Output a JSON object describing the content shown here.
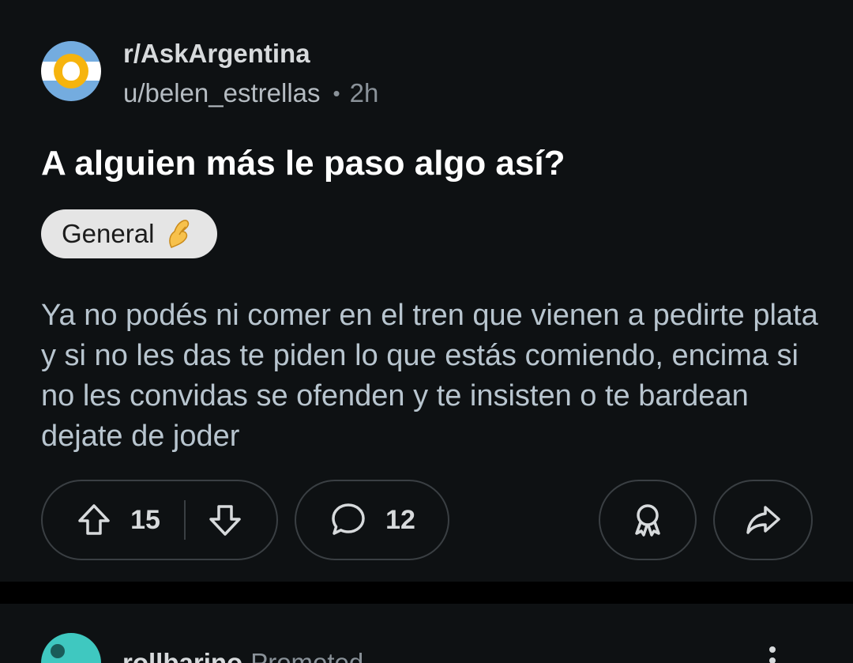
{
  "post": {
    "subreddit": "r/AskArgentina",
    "author": "u/belen_estrellas",
    "separator": "•",
    "time": "2h",
    "title": "A alguien más le paso algo así?",
    "flair": {
      "label": "General",
      "emoji": "pinched-fingers-emoji"
    },
    "body": "Ya no podés ni comer en el tren que vienen a pedirte plata y si no les das te piden lo que estás comiendo, encima si no les convidas se ofenden y te insisten o te bardean dejate de joder",
    "actions": {
      "upvotes": "15",
      "comments": "12"
    }
  },
  "next_post": {
    "name": "rollbarino",
    "badge": "Promoted"
  },
  "colors": {
    "background": "#0e1113",
    "divider": "#000000",
    "flair_bg": "#e5e5e5",
    "body_text": "#b8c5cf",
    "pill_border": "#3a3f43"
  },
  "icons": [
    "upvote-icon",
    "downvote-icon",
    "comment-icon",
    "award-icon",
    "share-icon",
    "more-vertical-icon"
  ]
}
